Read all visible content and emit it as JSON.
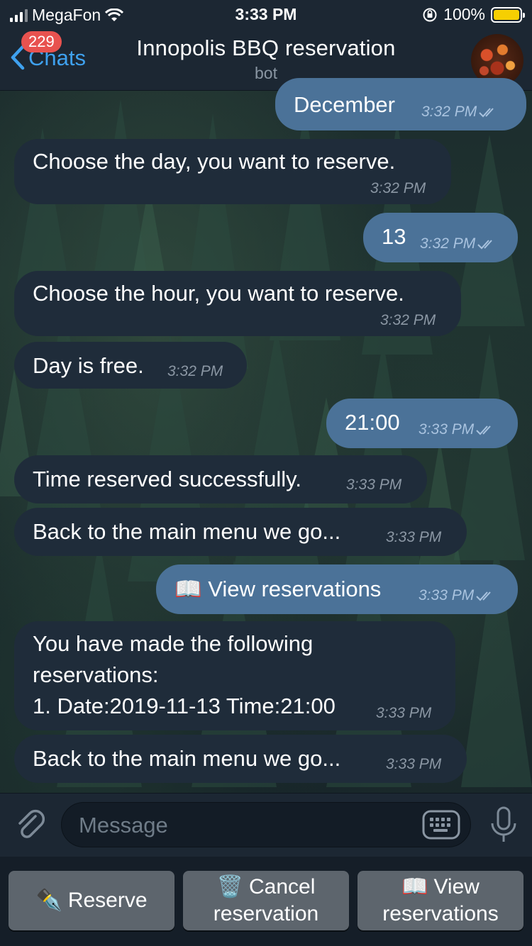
{
  "status_bar": {
    "carrier": "MegaFon",
    "time": "3:33 PM",
    "battery": "100%",
    "battery_color": "#f6cf02"
  },
  "header": {
    "back_label": "Chats",
    "unread_badge": "229",
    "title": "Innopolis BBQ reservation",
    "subtitle": "bot",
    "accent_color": "#3fa1ef"
  },
  "messages": [
    {
      "direction": "out",
      "text": "December",
      "time": "3:32 PM"
    },
    {
      "direction": "in",
      "text": "Choose the day, you want to reserve.",
      "time": "3:32 PM"
    },
    {
      "direction": "out",
      "text": "13",
      "time": "3:32 PM"
    },
    {
      "direction": "in",
      "text": "Choose the hour, you want to reserve.",
      "time": "3:32 PM"
    },
    {
      "direction": "in",
      "text": "Day is free.",
      "time": "3:32 PM"
    },
    {
      "direction": "out",
      "text": "21:00",
      "time": "3:33 PM"
    },
    {
      "direction": "in",
      "text": "Time reserved successfully.",
      "time": "3:33 PM"
    },
    {
      "direction": "in",
      "text": "Back to the main menu we go...",
      "time": "3:33 PM"
    },
    {
      "direction": "out",
      "text": "📖 View reservations",
      "time": "3:33 PM"
    },
    {
      "direction": "in",
      "lines": [
        "You have made the following",
        "reservations:",
        "1. Date:2019-11-13 Time:21:00"
      ],
      "time": "3:33 PM"
    },
    {
      "direction": "in",
      "text": "Back to the main menu we go...",
      "time": "3:33 PM"
    }
  ],
  "composer": {
    "placeholder": "Message"
  },
  "keyboard": {
    "buttons": [
      {
        "icon": "✒️",
        "lines": [
          "Reserve"
        ]
      },
      {
        "icon": "🗑️",
        "lines": [
          "Cancel",
          "reservation"
        ]
      },
      {
        "icon": "📖",
        "lines": [
          "View",
          "reservations"
        ]
      }
    ]
  }
}
